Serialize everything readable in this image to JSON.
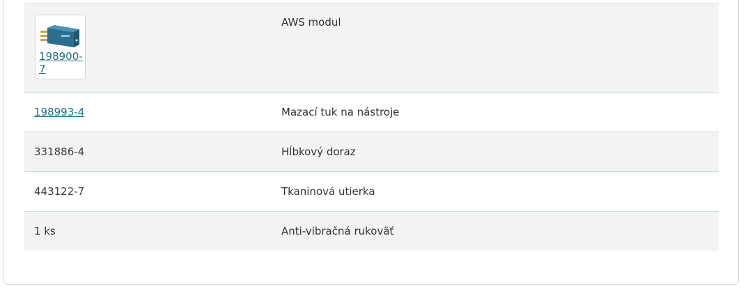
{
  "table": {
    "rows": [
      {
        "code": "198900-7",
        "description": "AWS modul",
        "code_is_link": true,
        "has_image": true,
        "image_icon": "aws-module-icon"
      },
      {
        "code": "198993-4",
        "description": "Mazací tuk na nástroje",
        "code_is_link": true
      },
      {
        "code": "331886-4",
        "description": "Hĺbkový doraz",
        "code_is_link": false
      },
      {
        "code": "443122-7",
        "description": "Tkaninová utierka",
        "code_is_link": false
      },
      {
        "code": "1 ks",
        "description": "Anti-vibračná rukoväť",
        "code_is_link": false
      }
    ]
  },
  "colors": {
    "link": "#1f6e7f",
    "row_shaded": "#f3f3f3",
    "divider": "#c5dbe1",
    "module_body": "#2a6f8f"
  }
}
